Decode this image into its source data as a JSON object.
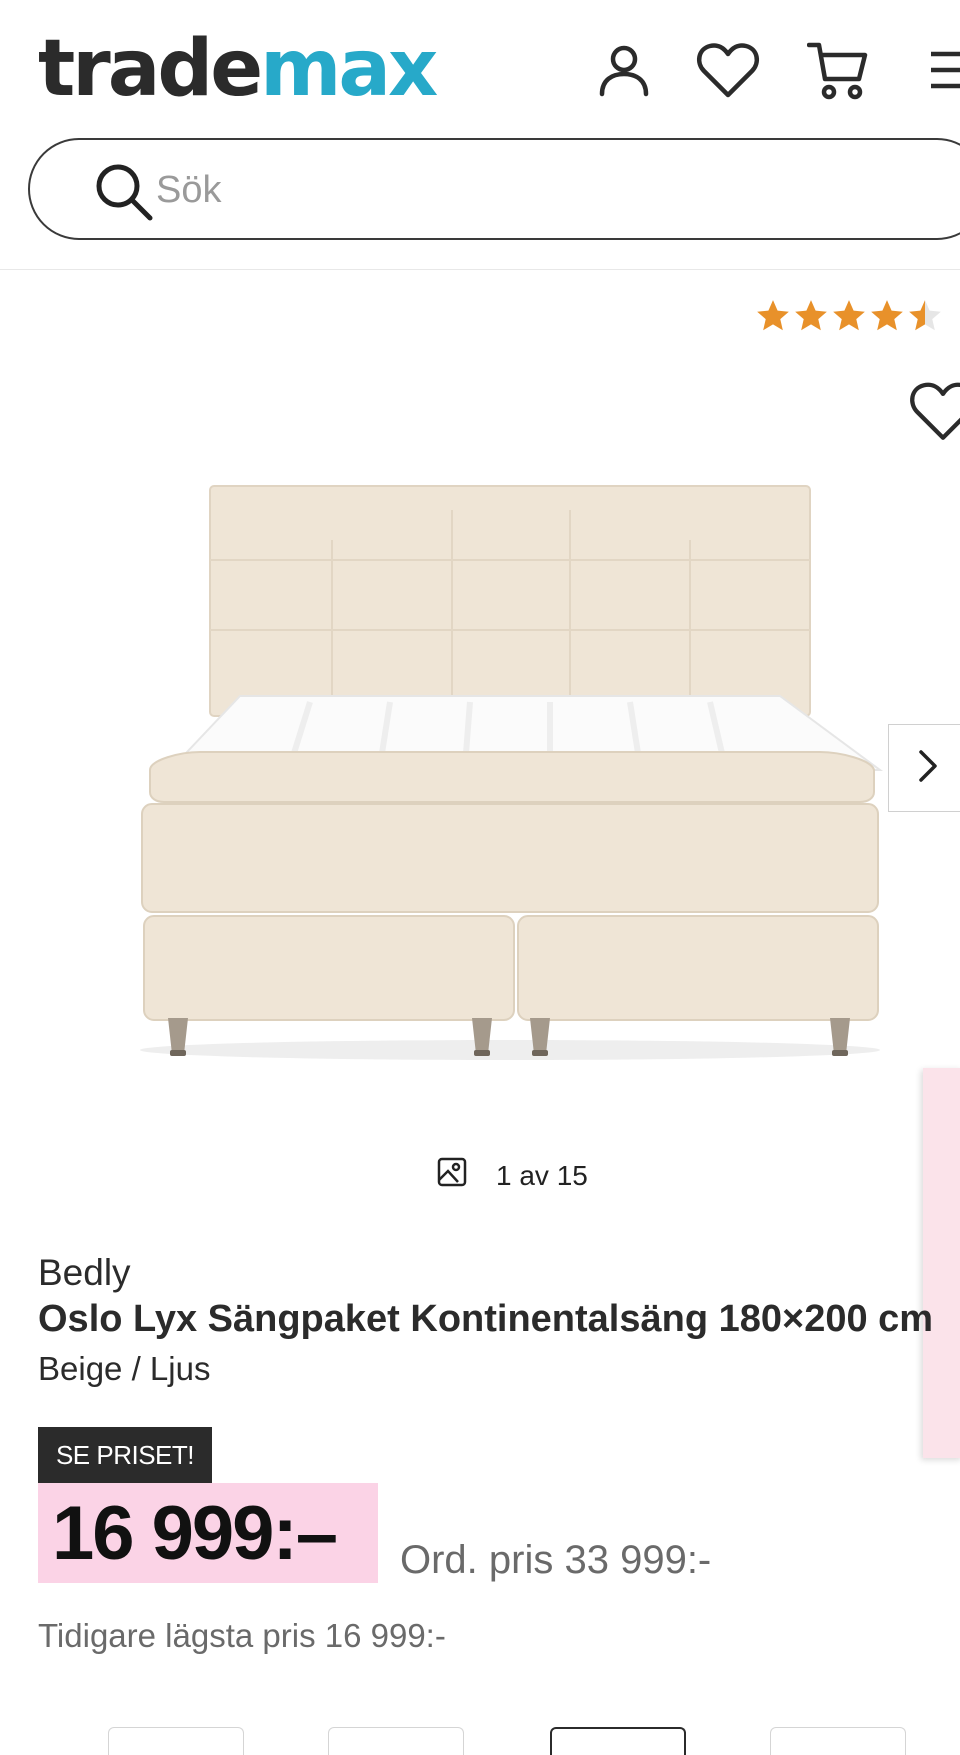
{
  "header": {
    "logo_part1": "trade",
    "logo_part2": "max",
    "icons": [
      "user-icon",
      "heart-icon",
      "cart-icon",
      "menu-icon"
    ]
  },
  "search": {
    "placeholder": "Sök"
  },
  "rating": {
    "stars": 4.5,
    "max": 5,
    "count_text": "("
  },
  "gallery": {
    "counter": "1 av 15"
  },
  "product": {
    "brand": "Bedly",
    "title": "Oslo Lyx Sängpaket Kontinentalsäng 180×200 cm",
    "variant": "Beige / Ljus",
    "badge": "SE PRISET!",
    "price": "16 999:–",
    "ordinary_price": "Ord. pris 33 999:-",
    "lowest_price": "Tidigare lägsta pris 16 999:-"
  },
  "colors": {
    "brand_dark": "#2b2b2b",
    "brand_accent": "#27a9c9",
    "price_bg": "#fbd3e6",
    "star": "#e8912a"
  }
}
